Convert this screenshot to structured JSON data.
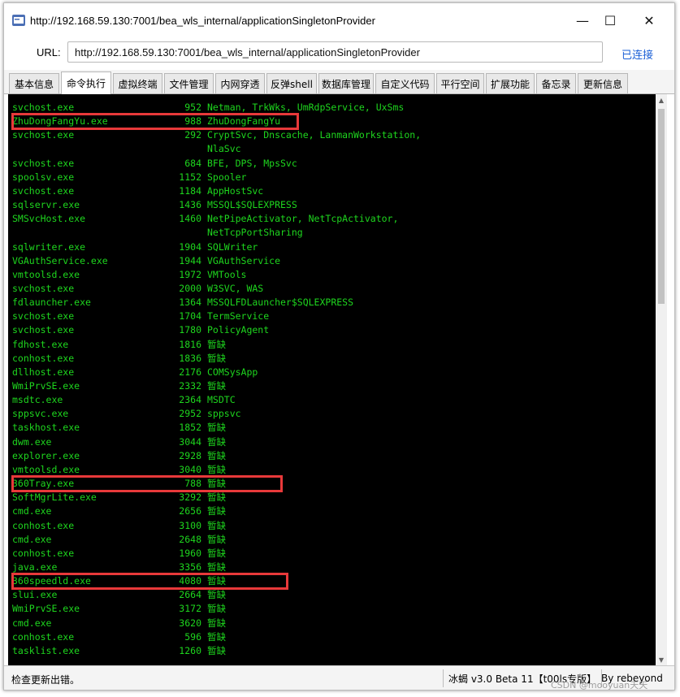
{
  "window": {
    "title": "http://192.168.59.130:7001/bea_wls_internal/applicationSingletonProvider",
    "minimize_label": "—",
    "maximize_label": "☐",
    "close_label": "✕"
  },
  "urlbar": {
    "label": "URL:",
    "value": "http://192.168.59.130:7001/bea_wls_internal/applicationSingletonProvider",
    "status": "已连接"
  },
  "tabs": [
    {
      "label": "基本信息",
      "active": false
    },
    {
      "label": "命令执行",
      "active": true
    },
    {
      "label": "虚拟终端",
      "active": false
    },
    {
      "label": "文件管理",
      "active": false
    },
    {
      "label": "内网穿透",
      "active": false
    },
    {
      "label": "反弹shell",
      "active": false
    },
    {
      "label": "数据库管理",
      "active": false
    },
    {
      "label": "自定义代码",
      "active": false
    },
    {
      "label": "平行空间",
      "active": false
    },
    {
      "label": "扩展功能",
      "active": false
    },
    {
      "label": "备忘录",
      "active": false
    },
    {
      "label": "更新信息",
      "active": false
    }
  ],
  "console": {
    "lines": [
      {
        "name": "svchost.exe",
        "pid": "952",
        "service": "Netman, TrkWks, UmRdpService, UxSms"
      },
      {
        "name": "ZhuDongFangYu.exe",
        "pid": "988",
        "service": "ZhuDongFangYu"
      },
      {
        "name": "svchost.exe",
        "pid": "292",
        "service": "CryptSvc, Dnscache, LanmanWorkstation,"
      },
      {
        "name": "",
        "pid": "",
        "service": "NlaSvc"
      },
      {
        "name": "svchost.exe",
        "pid": "684",
        "service": "BFE, DPS, MpsSvc"
      },
      {
        "name": "spoolsv.exe",
        "pid": "1152",
        "service": "Spooler"
      },
      {
        "name": "svchost.exe",
        "pid": "1184",
        "service": "AppHostSvc"
      },
      {
        "name": "sqlservr.exe",
        "pid": "1436",
        "service": "MSSQL$SQLEXPRESS"
      },
      {
        "name": "SMSvcHost.exe",
        "pid": "1460",
        "service": "NetPipeActivator, NetTcpActivator,"
      },
      {
        "name": "",
        "pid": "",
        "service": "NetTcpPortSharing"
      },
      {
        "name": "sqlwriter.exe",
        "pid": "1904",
        "service": "SQLWriter"
      },
      {
        "name": "VGAuthService.exe",
        "pid": "1944",
        "service": "VGAuthService"
      },
      {
        "name": "vmtoolsd.exe",
        "pid": "1972",
        "service": "VMTools"
      },
      {
        "name": "svchost.exe",
        "pid": "2000",
        "service": "W3SVC, WAS"
      },
      {
        "name": "fdlauncher.exe",
        "pid": "1364",
        "service": "MSSQLFDLauncher$SQLEXPRESS"
      },
      {
        "name": "svchost.exe",
        "pid": "1704",
        "service": "TermService"
      },
      {
        "name": "svchost.exe",
        "pid": "1780",
        "service": "PolicyAgent"
      },
      {
        "name": "fdhost.exe",
        "pid": "1816",
        "service": "暂缺"
      },
      {
        "name": "conhost.exe",
        "pid": "1836",
        "service": "暂缺"
      },
      {
        "name": "dllhost.exe",
        "pid": "2176",
        "service": "COMSysApp"
      },
      {
        "name": "WmiPrvSE.exe",
        "pid": "2332",
        "service": "暂缺"
      },
      {
        "name": "msdtc.exe",
        "pid": "2364",
        "service": "MSDTC"
      },
      {
        "name": "sppsvc.exe",
        "pid": "2952",
        "service": "sppsvc"
      },
      {
        "name": "taskhost.exe",
        "pid": "1852",
        "service": "暂缺"
      },
      {
        "name": "dwm.exe",
        "pid": "3044",
        "service": "暂缺"
      },
      {
        "name": "explorer.exe",
        "pid": "2928",
        "service": "暂缺"
      },
      {
        "name": "vmtoolsd.exe",
        "pid": "3040",
        "service": "暂缺"
      },
      {
        "name": "360Tray.exe",
        "pid": "788",
        "service": "暂缺"
      },
      {
        "name": "SoftMgrLite.exe",
        "pid": "3292",
        "service": "暂缺"
      },
      {
        "name": "cmd.exe",
        "pid": "2656",
        "service": "暂缺"
      },
      {
        "name": "conhost.exe",
        "pid": "3100",
        "service": "暂缺"
      },
      {
        "name": "cmd.exe",
        "pid": "2648",
        "service": "暂缺"
      },
      {
        "name": "conhost.exe",
        "pid": "1960",
        "service": "暂缺"
      },
      {
        "name": "java.exe",
        "pid": "3356",
        "service": "暂缺"
      },
      {
        "name": "360speedld.exe",
        "pid": "4080",
        "service": "暂缺"
      },
      {
        "name": "slui.exe",
        "pid": "2664",
        "service": "暂缺"
      },
      {
        "name": "WmiPrvSE.exe",
        "pid": "3172",
        "service": "暂缺"
      },
      {
        "name": "cmd.exe",
        "pid": "3620",
        "service": "暂缺"
      },
      {
        "name": "conhost.exe",
        "pid": "596",
        "service": "暂缺"
      },
      {
        "name": "tasklist.exe",
        "pid": "1260",
        "service": "暂缺"
      }
    ],
    "highlight_color": "#e8393a",
    "text_color": "#1ed61e"
  },
  "statusbar": {
    "message": "检查更新出错。",
    "version": "冰蝎 v3.0 Beta 11【t00ls专版】",
    "author": "By rebeyond"
  },
  "watermark": "CSDN @mooyuan天天"
}
